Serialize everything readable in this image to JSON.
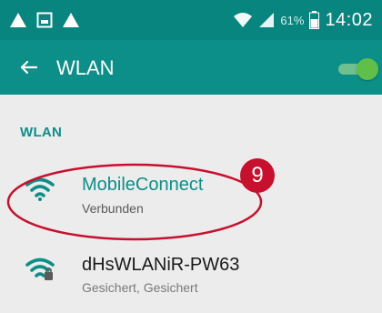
{
  "status_bar": {
    "left_icons": [
      "alert-triangle-icon",
      "image-icon",
      "alert-triangle-icon"
    ],
    "right_icons": [
      "wifi-signal-icon",
      "cell-signal-icon",
      "battery-icon"
    ],
    "battery_percent": "61%",
    "time": "14:02"
  },
  "app_bar": {
    "title": "WLAN",
    "back_icon": "arrow-left-icon",
    "wlan_enabled": true
  },
  "wlan_list": {
    "section_header": "WLAN",
    "networks": [
      {
        "name": "MobileConnect",
        "status": "Verbunden",
        "icon": "wifi-icon",
        "secured": false
      },
      {
        "name": "dHsWLANiR-PW63",
        "status": "Gesichert, Gesichert",
        "icon": "wifi-lock-icon",
        "secured": true
      }
    ]
  },
  "annotation": {
    "step_number": "9",
    "color": "#c8102e"
  },
  "colors": {
    "status_bar": "#07857e",
    "app_bar": "#0b8f88",
    "accent": "#0b8f88",
    "toggle_on": "#5fbf49"
  }
}
